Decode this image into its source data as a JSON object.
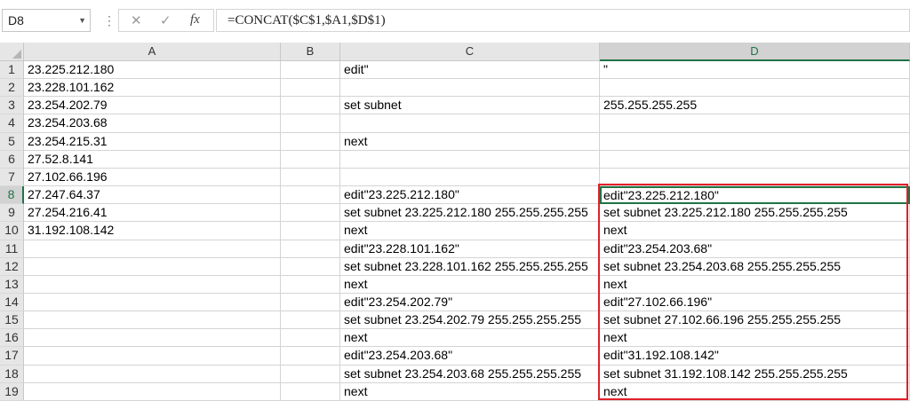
{
  "name_box": "D8",
  "formula": "=CONCAT($C$1,$A1,$D$1)",
  "columns": [
    "A",
    "B",
    "C",
    "D"
  ],
  "active_column": "D",
  "active_row": 8,
  "rows": [
    {
      "num": "1",
      "A": "23.225.212.180",
      "B": "",
      "C": "edit\"",
      "D": "\""
    },
    {
      "num": "2",
      "A": "23.228.101.162",
      "B": "",
      "C": "",
      "D": ""
    },
    {
      "num": "3",
      "A": "23.254.202.79",
      "B": "",
      "C": "set subnet",
      "D": " 255.255.255.255"
    },
    {
      "num": "4",
      "A": "23.254.203.68",
      "B": "",
      "C": "",
      "D": ""
    },
    {
      "num": "5",
      "A": "23.254.215.31",
      "B": "",
      "C": "next",
      "D": ""
    },
    {
      "num": "6",
      "A": "27.52.8.141",
      "B": "",
      "C": "",
      "D": ""
    },
    {
      "num": "7",
      "A": "27.102.66.196",
      "B": "",
      "C": "",
      "D": ""
    },
    {
      "num": "8",
      "A": "27.247.64.37",
      "B": "",
      "C": "edit\"23.225.212.180\"",
      "D": "edit\"23.225.212.180\""
    },
    {
      "num": "9",
      "A": "27.254.216.41",
      "B": "",
      "C": "set subnet 23.225.212.180 255.255.255.255",
      "D": "set subnet 23.225.212.180 255.255.255.255"
    },
    {
      "num": "10",
      "A": "31.192.108.142",
      "B": "",
      "C": "next",
      "D": "next"
    },
    {
      "num": "11",
      "A": "",
      "B": "",
      "C": "edit\"23.228.101.162\"",
      "D": "edit\"23.254.203.68\""
    },
    {
      "num": "12",
      "A": "",
      "B": "",
      "C": "set subnet 23.228.101.162 255.255.255.255",
      "D": "set subnet 23.254.203.68 255.255.255.255"
    },
    {
      "num": "13",
      "A": "",
      "B": "",
      "C": "next",
      "D": "next"
    },
    {
      "num": "14",
      "A": "",
      "B": "",
      "C": "edit\"23.254.202.79\"",
      "D": "edit\"27.102.66.196\""
    },
    {
      "num": "15",
      "A": "",
      "B": "",
      "C": "set subnet 23.254.202.79 255.255.255.255",
      "D": "set subnet 27.102.66.196 255.255.255.255"
    },
    {
      "num": "16",
      "A": "",
      "B": "",
      "C": "next",
      "D": "next"
    },
    {
      "num": "17",
      "A": "",
      "B": "",
      "C": "edit\"23.254.203.68\"",
      "D": "edit\"31.192.108.142\""
    },
    {
      "num": "18",
      "A": "",
      "B": "",
      "C": "set subnet 23.254.203.68 255.255.255.255",
      "D": "set subnet 31.192.108.142 255.255.255.255"
    },
    {
      "num": "19",
      "A": "",
      "B": "",
      "C": "next",
      "D": "next"
    }
  ],
  "colors": {
    "accent": "#217346",
    "highlight_box": "#e0202a"
  },
  "icons": {
    "cancel": "close-icon",
    "enter": "check-icon",
    "function": "fx-icon"
  }
}
